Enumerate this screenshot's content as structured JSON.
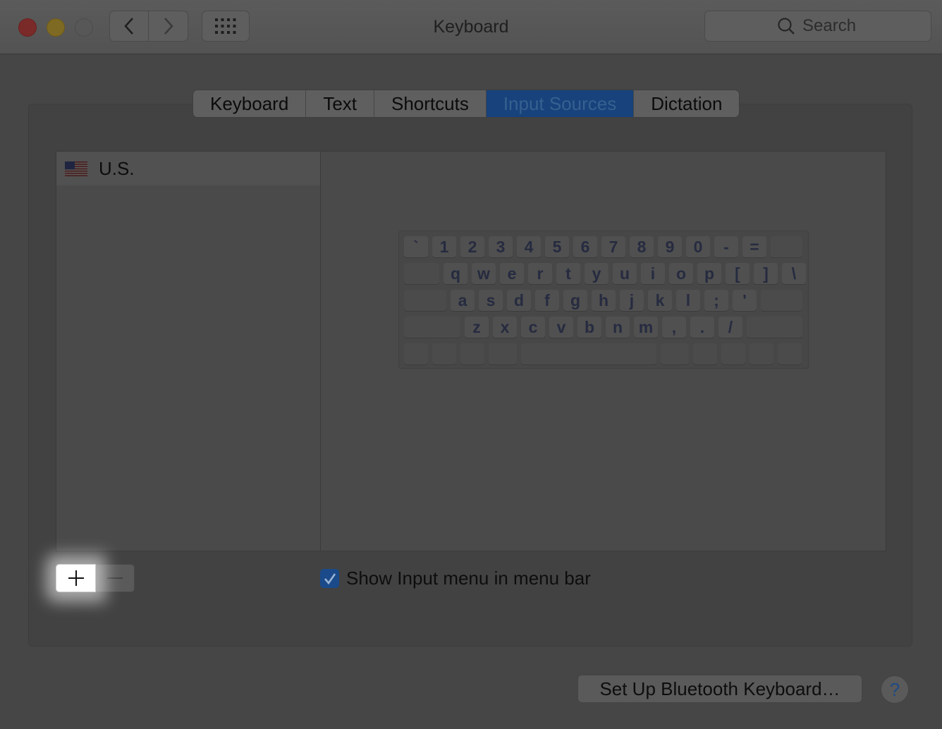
{
  "window": {
    "title": "Keyboard",
    "search_placeholder": "Search"
  },
  "tabs": [
    {
      "label": "Keyboard",
      "selected": false
    },
    {
      "label": "Text",
      "selected": false
    },
    {
      "label": "Shortcuts",
      "selected": false
    },
    {
      "label": "Input Sources",
      "selected": true
    },
    {
      "label": "Dictation",
      "selected": false
    }
  ],
  "input_sources": [
    {
      "label": "U.S.",
      "icon": "us-flag-icon",
      "selected": true
    }
  ],
  "keyboard_layout": {
    "row1": [
      "`",
      "1",
      "2",
      "3",
      "4",
      "5",
      "6",
      "7",
      "8",
      "9",
      "0",
      "-",
      "="
    ],
    "row2": [
      "q",
      "w",
      "e",
      "r",
      "t",
      "y",
      "u",
      "i",
      "o",
      "p",
      "[",
      "]",
      "\\"
    ],
    "row3": [
      "a",
      "s",
      "d",
      "f",
      "g",
      "h",
      "j",
      "k",
      "l",
      ";",
      "'"
    ],
    "row4": [
      "z",
      "x",
      "c",
      "v",
      "b",
      "n",
      "m",
      ",",
      ".",
      "/"
    ]
  },
  "controls": {
    "add_icon": "plus-icon",
    "remove_icon": "minus-icon",
    "show_input_menu_label": "Show Input menu in menu bar",
    "show_input_menu_checked": true,
    "bluetooth_button_label": "Set Up Bluetooth Keyboard…",
    "help_label": "?"
  },
  "colors": {
    "accent": "#17427c",
    "highlight": "#ffffff"
  }
}
